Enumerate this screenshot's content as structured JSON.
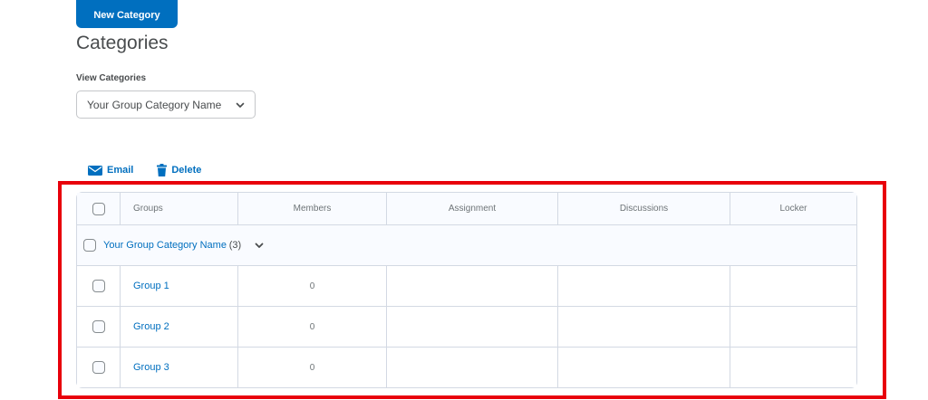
{
  "header": {
    "new_category_label": "New Category",
    "title": "Categories"
  },
  "view": {
    "label": "View Categories",
    "selected": "Your Group Category Name"
  },
  "toolbar": {
    "email_label": "Email",
    "delete_label": "Delete"
  },
  "table": {
    "columns": [
      "Groups",
      "Members",
      "Assignment",
      "Discussions",
      "Locker"
    ],
    "category": {
      "name": "Your Group Category Name",
      "count": "(3)"
    },
    "rows": [
      {
        "group": "Group 1",
        "members": "0"
      },
      {
        "group": "Group 2",
        "members": "0"
      },
      {
        "group": "Group 3",
        "members": "0"
      }
    ]
  },
  "colors": {
    "accent": "#006fbf",
    "highlight": "#e8000b"
  },
  "icons": [
    "chevron-down-icon",
    "email-icon",
    "trash-icon"
  ]
}
